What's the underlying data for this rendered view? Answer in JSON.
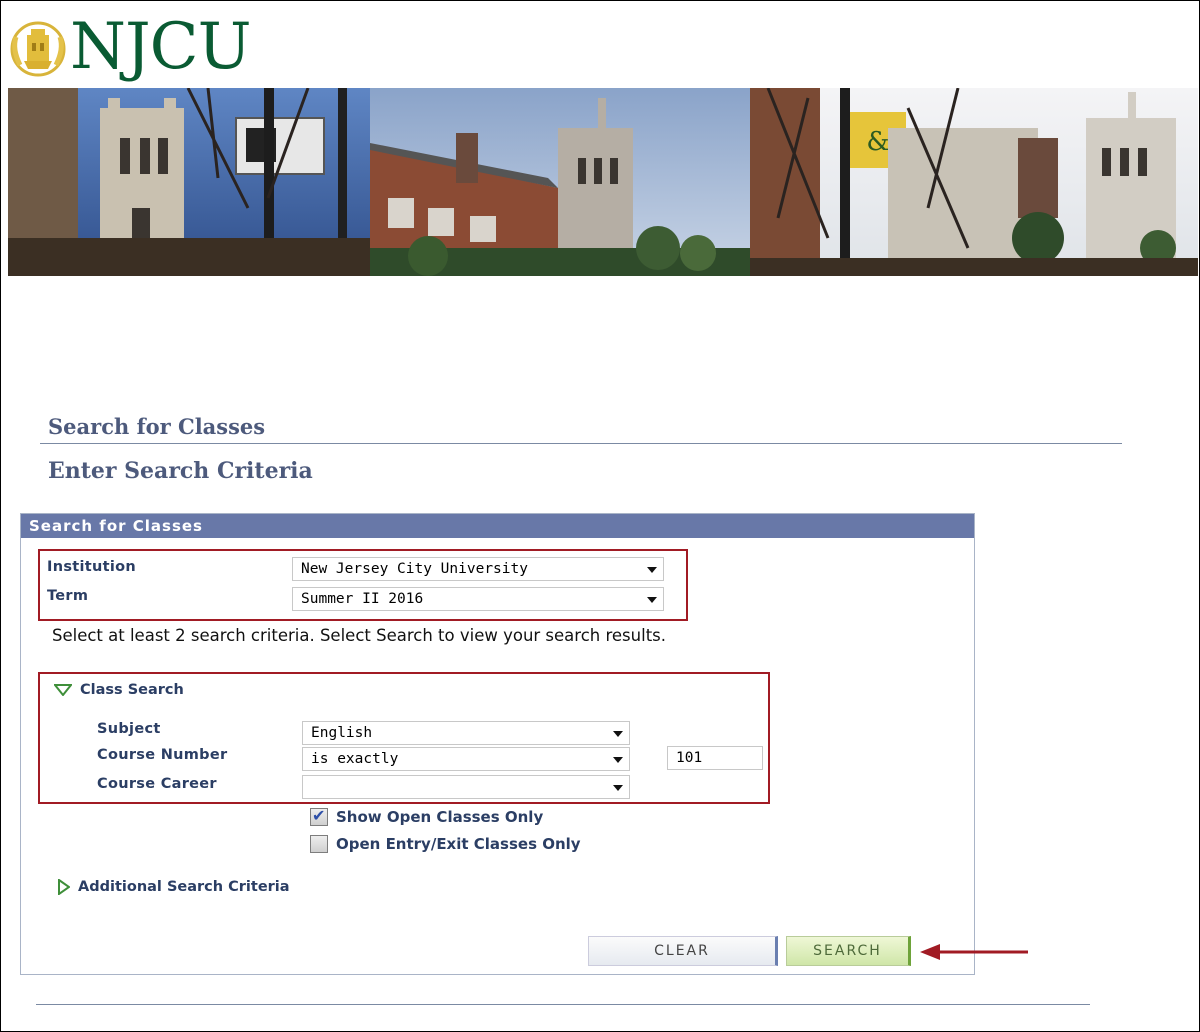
{
  "header": {
    "logo_text": "NJCU"
  },
  "page": {
    "title": "Search for Classes",
    "subtitle": "Enter Search Criteria"
  },
  "panel": {
    "header": "Search for Classes",
    "institution": {
      "label": "Institution",
      "value": "New Jersey City University"
    },
    "term": {
      "label": "Term",
      "value": "Summer II 2016"
    },
    "instruction": "Select at least 2 search criteria. Select Search to view your search results.",
    "class_search": {
      "toggle_label": "Class Search",
      "subject": {
        "label": "Subject",
        "value": "English"
      },
      "course_number": {
        "label": "Course Number",
        "operator": "is exactly",
        "value": "101"
      },
      "course_career": {
        "label": "Course Career",
        "value": ""
      }
    },
    "show_open_only": {
      "label": "Show Open Classes Only",
      "checked": true
    },
    "open_entry_exit": {
      "label": "Open Entry/Exit Classes Only",
      "checked": false
    },
    "additional_criteria": "Additional Search Criteria",
    "buttons": {
      "clear": "CLEAR",
      "search": "SEARCH"
    }
  },
  "colors": {
    "brand_green": "#0a5b33",
    "header_blue": "#6878a8",
    "label_navy": "#2b3e64",
    "annotation_red": "#a11b24"
  }
}
